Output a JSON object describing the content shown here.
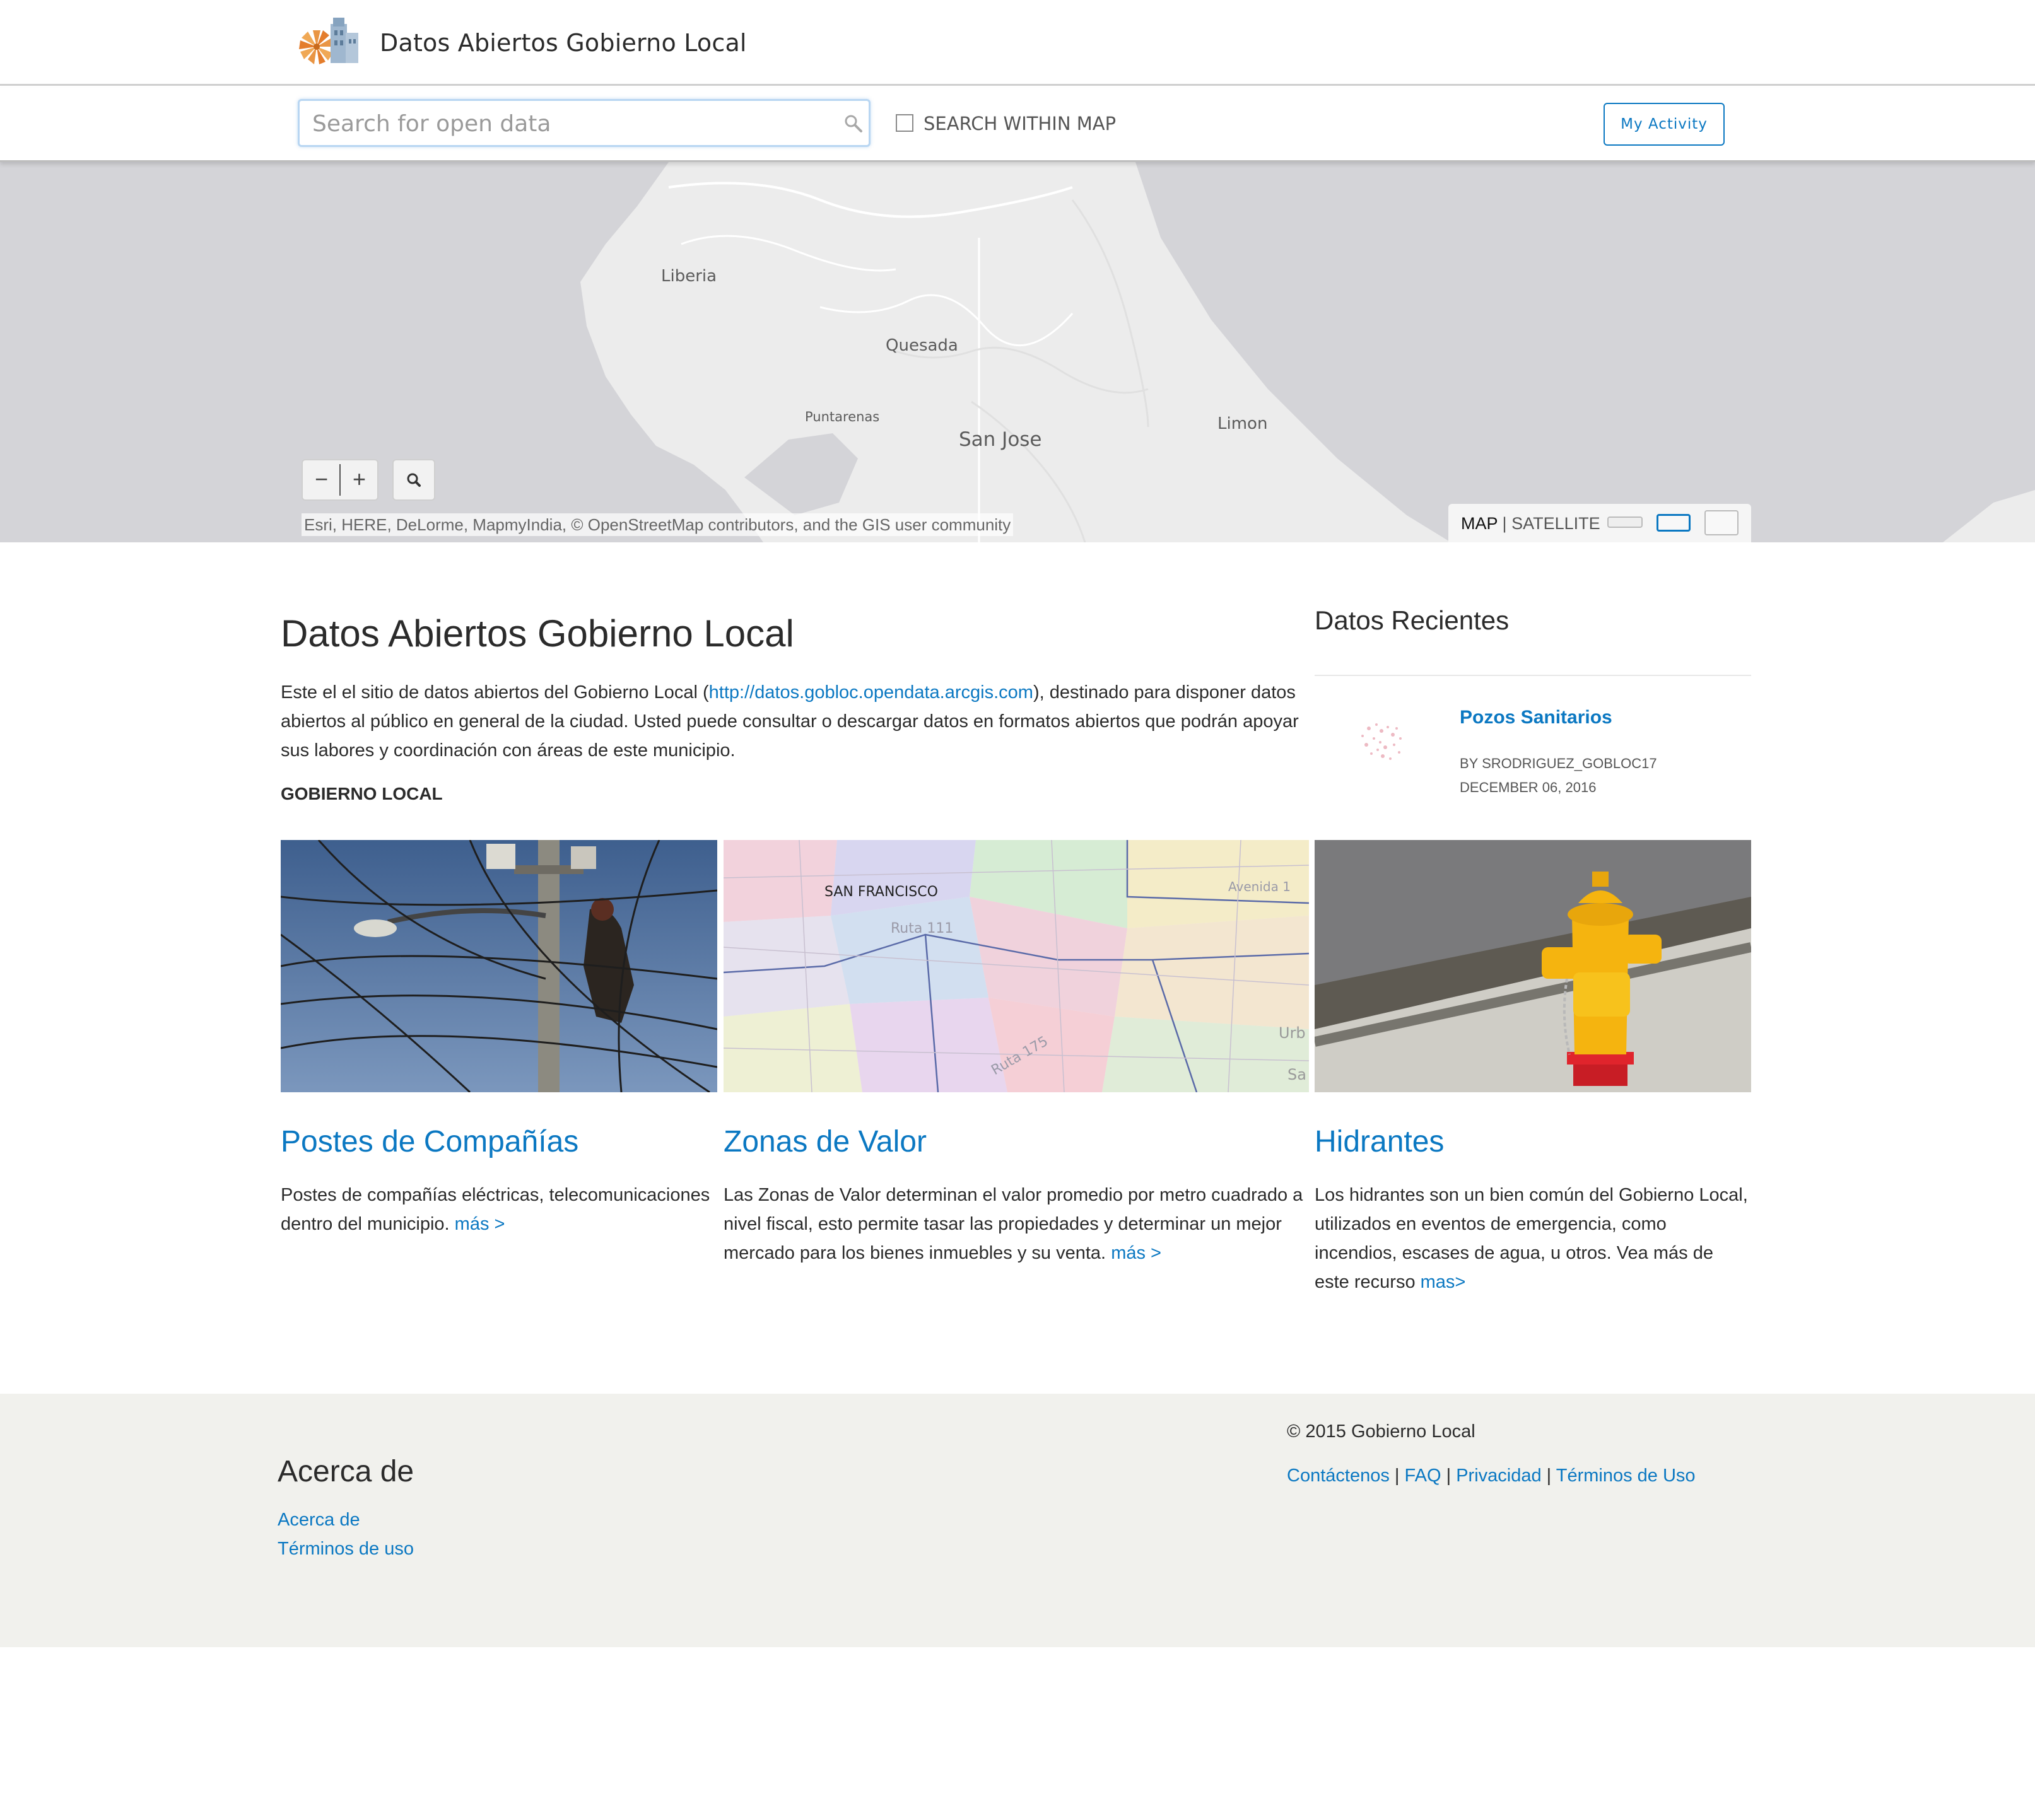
{
  "header": {
    "site_title": "Datos Abiertos Gobierno Local"
  },
  "search": {
    "placeholder": "Search for open data",
    "value": "",
    "within_map_label": "SEARCH WITHIN MAP",
    "within_map_checked": false,
    "my_activity_label": "My Activity"
  },
  "map": {
    "places": [
      {
        "name": "Liberia"
      },
      {
        "name": "Quesada"
      },
      {
        "name": "Puntarenas"
      },
      {
        "name": "San Jose"
      },
      {
        "name": "Limon"
      }
    ],
    "zoom_out": "−",
    "zoom_in": "+",
    "attribution": "Esri, HERE, DeLorme, MapmyIndia, © OpenStreetMap contributors, and the GIS user community",
    "basemap_map": "MAP",
    "basemap_sep": "|",
    "basemap_satellite": "SATELLITE"
  },
  "main": {
    "title": "Datos Abiertos Gobierno Local",
    "intro_before": "Este el el sitio de datos abiertos del Gobierno Local (",
    "intro_link": "http://datos.gobloc.opendata.arcgis.com",
    "intro_after": "), destinado para disponer datos abiertos al público en general de la ciudad. Usted puede consultar o descargar datos en formatos abiertos que podrán apoyar sus labores y coordinación con áreas de este municipio.",
    "org": "GOBIERNO LOCAL"
  },
  "recent": {
    "title": "Datos Recientes",
    "items": [
      {
        "title": "Pozos Sanitarios",
        "by": "BY SRODRIGUEZ_GOBLOC17",
        "date": "DECEMBER 06, 2016"
      }
    ]
  },
  "cards": [
    {
      "title": "Postes de Compañías",
      "desc": "Postes de compañías eléctricas, telecomunicaciones dentro del municipio.",
      "more": "más >"
    },
    {
      "title": "Zonas de Valor",
      "desc": "Las Zonas de Valor determinan el valor promedio por metro cuadrado a nivel fiscal, esto permite tasar las propiedades y determinar un mejor mercado para los bienes inmuebles y su venta.",
      "more": "más >",
      "map_labels": [
        "SAN FRANCISCO",
        "Ruta 111",
        "Ruta 175",
        "Avenida 1",
        "Urb",
        "Sa"
      ]
    },
    {
      "title": "Hidrantes",
      "desc": "Los hidrantes son un bien común del Gobierno Local, utilizados en eventos de emergencia, como incendios, escases de agua, u otros. Vea más de este recurso",
      "more": "mas>"
    }
  ],
  "footer": {
    "about_title": "Acerca de",
    "about_links": [
      "Acerca de",
      "Términos de uso"
    ],
    "copyright": "© 2015 Gobierno Local",
    "links": [
      "Contáctenos",
      "FAQ",
      "Privacidad",
      "Términos de Uso"
    ],
    "link_sep": "|"
  },
  "colors": {
    "accent": "#0b78c2",
    "map_water": "#d4d4d8",
    "map_land": "#ececec",
    "footer_bg": "#f1f1ed"
  }
}
